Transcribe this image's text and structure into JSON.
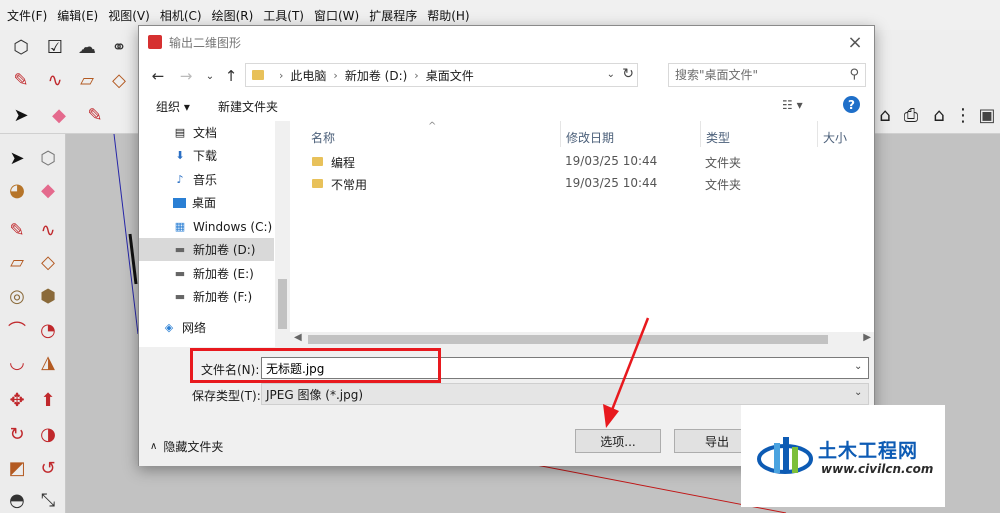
{
  "menubar": {
    "items": [
      "文件(F)",
      "编辑(E)",
      "视图(V)",
      "相机(C)",
      "绘图(R)",
      "工具(T)",
      "窗口(W)",
      "扩展程序",
      "帮助(H)"
    ]
  },
  "dialog": {
    "title": "输出二维图形",
    "close_icon": "×",
    "address": {
      "path": [
        "此电脑",
        "新加卷 (D:)",
        "桌面文件"
      ]
    },
    "search": {
      "placeholder": "搜索\"桌面文件\""
    },
    "commands": {
      "organize": "组织 ▾",
      "new_folder": "新建文件夹",
      "view": "☷ ▾",
      "help": "?"
    },
    "nav_items": [
      {
        "label": "文档",
        "icon": "document-icon"
      },
      {
        "label": "下载",
        "icon": "download-icon"
      },
      {
        "label": "音乐",
        "icon": "music-icon"
      },
      {
        "label": "桌面",
        "icon": "desktop-icon"
      },
      {
        "label": "Windows (C:)",
        "icon": "windows-drive-icon"
      },
      {
        "label": "新加卷 (D:)",
        "icon": "drive-icon",
        "selected": true
      },
      {
        "label": "新加卷 (E:)",
        "icon": "drive-icon"
      },
      {
        "label": "新加卷 (F:)",
        "icon": "drive-icon"
      },
      {
        "label": "网络",
        "icon": "network-icon"
      }
    ],
    "columns": {
      "name": "名称",
      "date": "修改日期",
      "type": "类型",
      "size": "大小"
    },
    "files": [
      {
        "name": "编程",
        "date": "19/03/25 10:44",
        "type": "文件夹"
      },
      {
        "name": "不常用",
        "date": "19/03/25 10:44",
        "type": "文件夹"
      }
    ],
    "filename": {
      "label": "文件名(N):",
      "value": "无标题.jpg"
    },
    "filetype": {
      "label": "保存类型(T):",
      "value": "JPEG 图像 (*.jpg)"
    },
    "hide_folders": "隐藏文件夹",
    "buttons": {
      "options": "选项...",
      "export": "导出"
    }
  },
  "annotation_color": "#e8191e",
  "watermark": {
    "brand": "土木工程网",
    "url": "www.civilcn.com"
  }
}
